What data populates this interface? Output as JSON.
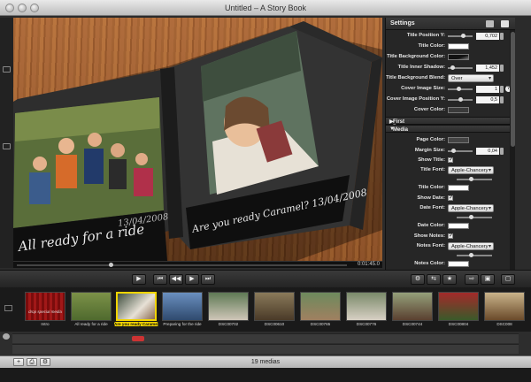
{
  "window": {
    "title": "Untitled – A Story Book"
  },
  "stage": {
    "left_page_caption": "All ready for a ride",
    "left_page_date": "13/04/2008",
    "right_page_caption": "Are you ready Caramel? 13/04/2008",
    "timecode": "0:01:45.0"
  },
  "settings": {
    "title": "Settings",
    "rows": {
      "title_position_y": {
        "label": "Title Position Y:",
        "value": "0,702"
      },
      "title_color": {
        "label": "Title Color:"
      },
      "title_bg_color": {
        "label": "Title Background Color:"
      },
      "title_inner_shadow": {
        "label": "Title Inner Shadow:",
        "value": "1,452"
      },
      "title_bg_blend": {
        "label": "Title Background Blend:",
        "value": "Over"
      },
      "cover_image_size": {
        "label": "Cover Image Size:",
        "value": "1"
      },
      "cover_image_pos_y": {
        "label": "Cover Image Position Y:",
        "value": "0,5"
      },
      "cover_color": {
        "label": "Cover Color:"
      }
    },
    "sections": {
      "first_page": "First Page",
      "media": "Media"
    },
    "media_rows": {
      "page_color": {
        "label": "Page Color:"
      },
      "margin_size": {
        "label": "Margin Size:",
        "value": "0,04"
      },
      "show_title": {
        "label": "Show Title:"
      },
      "title_font": {
        "label": "Title Font:",
        "value": "Apple-Chancery"
      },
      "title_color": {
        "label": "Title Color:"
      },
      "show_date": {
        "label": "Show Date:"
      },
      "date_font": {
        "label": "Date Font:",
        "value": "Apple-Chancery"
      },
      "date_color": {
        "label": "Date Color:"
      },
      "show_notes": {
        "label": "Show Notes:"
      },
      "notes_font": {
        "label": "Notes Font:",
        "value": "Apple-Chancery"
      },
      "notes_color": {
        "label": "Notes Color:"
      }
    },
    "help_glyph": "?"
  },
  "toolbar": {
    "play_glyph": "▶",
    "rewind_glyph": "⏮",
    "back_glyph": "◀◀",
    "forward_glyph": "▶",
    "next_glyph": "⏭"
  },
  "filmstrip": {
    "intro_label": "drop special media",
    "intro_name": "Intro",
    "items": [
      {
        "label": "All ready for a ride"
      },
      {
        "label": "Are you ready Caramel?",
        "selected": true
      },
      {
        "label": "Preparing for the ride"
      },
      {
        "label": "DSC00702"
      },
      {
        "label": "DSC00610"
      },
      {
        "label": "DSC00765"
      },
      {
        "label": "DSC00776"
      },
      {
        "label": "DSC00744"
      },
      {
        "label": "DSC00804"
      },
      {
        "label": "DSC008"
      }
    ]
  },
  "status": {
    "count": "19 medias"
  },
  "colors": {
    "accent": "#f1d400",
    "wood": "#a8622f",
    "panel": "#262626"
  }
}
